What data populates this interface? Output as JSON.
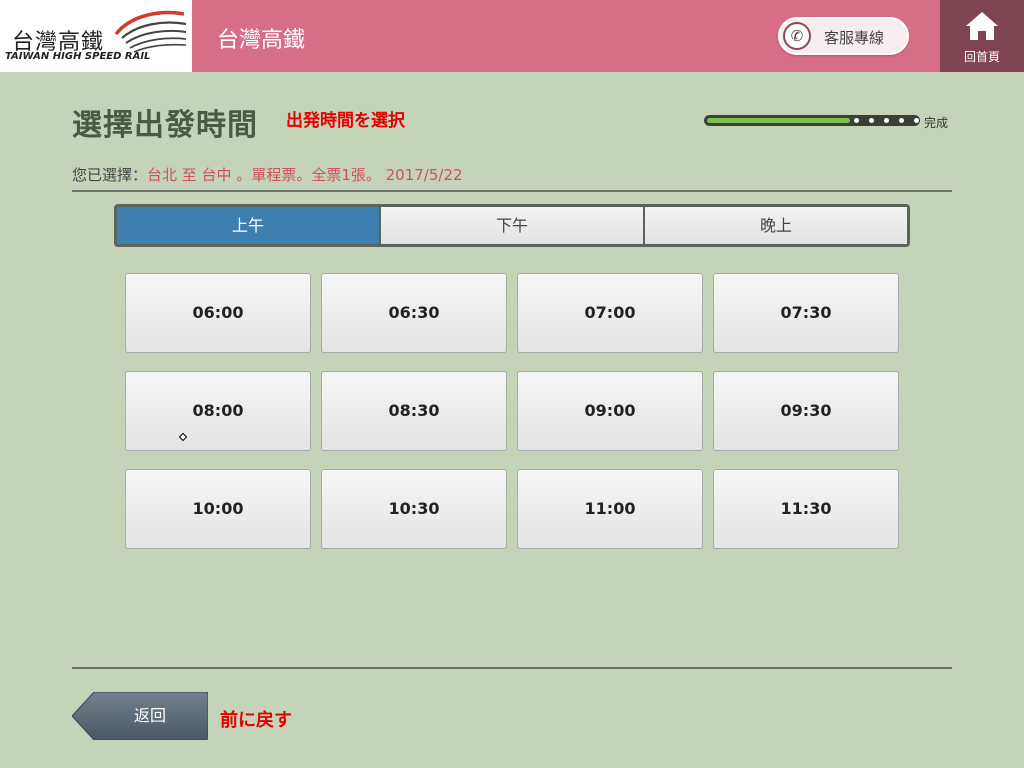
{
  "header": {
    "logo_text_cn": "台灣高鐵",
    "logo_text_en": "TAIWAN HIGH SPEED RAIL",
    "title": "台灣高鐵",
    "service_label": "客服專線",
    "service_icon": "phone-icon",
    "home_label": "回首頁",
    "home_icon": "home-icon"
  },
  "page": {
    "title": "選擇出發時間",
    "title_jp": "出発時間を選択",
    "progress_label": "完成",
    "progress_fraction": 0.68
  },
  "summary": {
    "label": "您已選擇：",
    "value": "台北 至 台中 。單程票。全票1張。 2017/5/22"
  },
  "tabs": [
    {
      "label": "上午",
      "active": true
    },
    {
      "label": "下午",
      "active": false
    },
    {
      "label": "晚上",
      "active": false
    }
  ],
  "times": [
    "06:00",
    "06:30",
    "07:00",
    "07:30",
    "08:00",
    "08:30",
    "09:00",
    "09:30",
    "10:00",
    "10:30",
    "11:00",
    "11:30"
  ],
  "footer": {
    "back_label": "返回",
    "back_jp": "前に戻す"
  },
  "colors": {
    "background": "#c5d4b8",
    "header": "#d66e87",
    "home": "#7f4451",
    "tab_active": "#3f7fb0",
    "accent_red": "#e60000",
    "progress_fill": "#7cc24a"
  }
}
